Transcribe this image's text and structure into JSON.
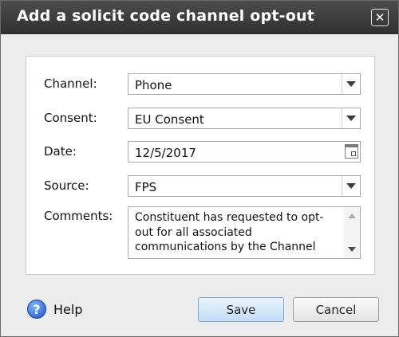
{
  "dialog": {
    "title": "Add a solicit code channel opt-out",
    "close_glyph": "✕"
  },
  "form": {
    "channel": {
      "label": "Channel:",
      "value": "Phone"
    },
    "consent": {
      "label": "Consent:",
      "value": "EU Consent"
    },
    "date": {
      "label": "Date:",
      "value": "12/5/2017"
    },
    "source": {
      "label": "Source:",
      "value": "FPS"
    },
    "comments": {
      "label": "Comments:",
      "value": "Constituent has requested to opt-out for all associated communications by the Channel"
    }
  },
  "footer": {
    "help_label": "Help",
    "help_glyph": "?",
    "save_label": "Save",
    "cancel_label": "Cancel"
  }
}
